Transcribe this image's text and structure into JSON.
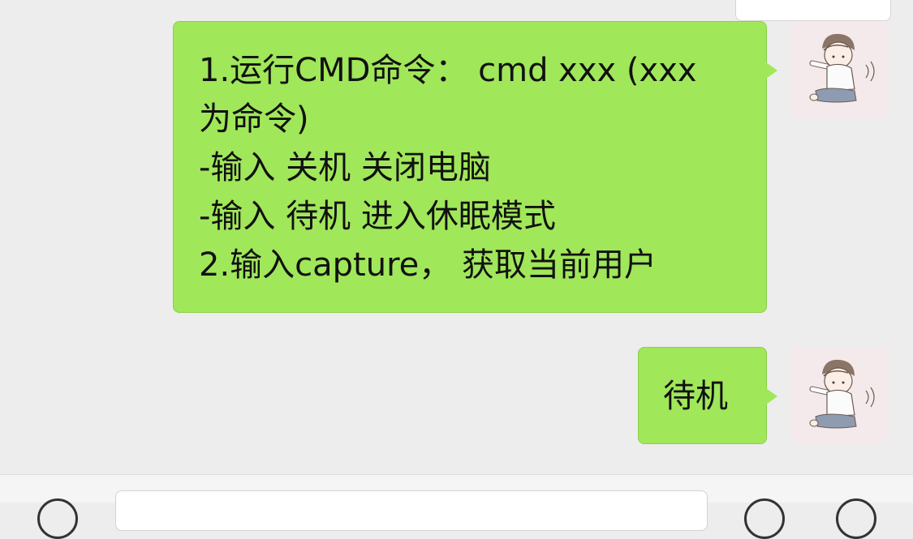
{
  "messages": [
    {
      "lines": [
        "1.运行CMD命令：  cmd xxx (xxx",
        "为命令)",
        "-输入 关机 关闭电脑",
        "-输入 待机 进入休眠模式",
        "2.输入capture，  获取当前用户"
      ],
      "sender": "self",
      "avatar_icon": "user-avatar-icon"
    },
    {
      "text": "待机",
      "sender": "self",
      "avatar_icon": "user-avatar-icon"
    }
  ],
  "input_bar": {
    "placeholder": "",
    "value": ""
  },
  "colors": {
    "chat_background": "#ededed",
    "bubble_self": "#a0e75a",
    "input_bar_background": "#f5f5f5"
  }
}
